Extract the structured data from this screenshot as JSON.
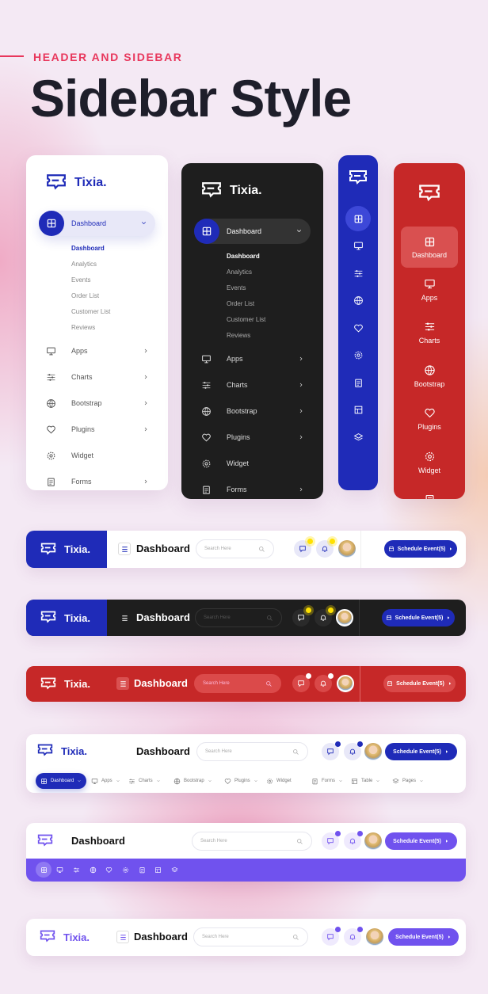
{
  "heading": {
    "kicker": "HEADER AND SIDEBAR",
    "title": "Sidebar Style"
  },
  "brand": {
    "name": "Tixia.",
    "logo_icon": "ticket-chat-icon"
  },
  "colors": {
    "accent": "#e8375c",
    "blue": "#1f2bb8",
    "dark": "#1e1e1e",
    "red": "#c62828",
    "purple": "#7052ee",
    "notify_yellow": "#ffe100"
  },
  "sidebar": {
    "active": {
      "label": "Dashboard",
      "icon": "dashboard-icon"
    },
    "submenu": [
      "Dashboard",
      "Analytics",
      "Events",
      "Order List",
      "Customer List",
      "Reviews"
    ],
    "items": [
      {
        "label": "Apps",
        "icon": "monitor-icon"
      },
      {
        "label": "Charts",
        "icon": "sliders-icon"
      },
      {
        "label": "Bootstrap",
        "icon": "globe-icon"
      },
      {
        "label": "Plugins",
        "icon": "heart-icon"
      },
      {
        "label": "Widget",
        "icon": "gear-icon"
      },
      {
        "label": "Forms",
        "icon": "clipboard-icon"
      }
    ],
    "compact_icons": [
      "dashboard-icon",
      "monitor-icon",
      "sliders-icon",
      "globe-icon",
      "heart-icon",
      "gear-icon",
      "clipboard-icon",
      "table-icon",
      "layers-icon"
    ]
  },
  "header": {
    "page_title": "Dashboard",
    "search_placeholder": "Search Here",
    "button_label": "Schedule Event(5)",
    "nav": [
      {
        "label": "Dashboard",
        "icon": "dashboard-icon",
        "active": true
      },
      {
        "label": "Apps",
        "icon": "monitor-icon"
      },
      {
        "label": "Charts",
        "icon": "sliders-icon"
      },
      {
        "label": "Bootstrap",
        "icon": "globe-icon"
      },
      {
        "label": "Plugins",
        "icon": "heart-icon"
      },
      {
        "label": "Widget",
        "icon": "gear-icon"
      },
      {
        "label": "Forms",
        "icon": "clipboard-icon"
      },
      {
        "label": "Table",
        "icon": "table-icon"
      },
      {
        "label": "Pages",
        "icon": "layers-icon"
      }
    ]
  }
}
